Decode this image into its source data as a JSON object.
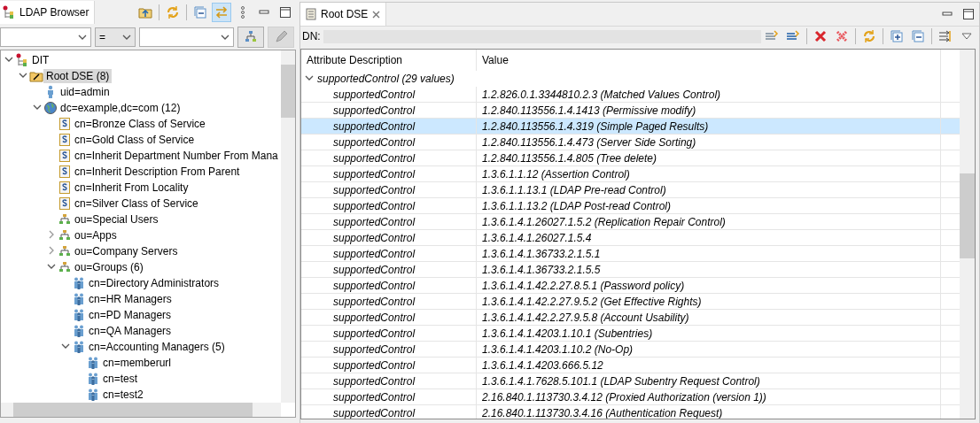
{
  "browser": {
    "title": "LDAP Browser",
    "tools": [
      {
        "kind": "open-connection",
        "pressed": false
      },
      {
        "kind": "refresh",
        "pressed": false
      },
      {
        "kind": "collapse",
        "pressed": false
      },
      {
        "kind": "link",
        "pressed": true
      },
      {
        "kind": "menu",
        "pressed": false
      },
      {
        "kind": "minimize",
        "pressed": false
      },
      {
        "kind": "maximize",
        "pressed": false
      }
    ],
    "filter": {
      "operator": "=",
      "buttons": [
        {
          "kind": "tree",
          "disabled": false
        },
        {
          "kind": "pencil",
          "disabled": true
        }
      ]
    },
    "tree": [
      {
        "label": "DIT",
        "kind": "dit",
        "expanded": true,
        "selected": false,
        "children": [
          {
            "label": "Root DSE (8)",
            "kind": "root",
            "expanded": true,
            "selected": true,
            "children": [
              {
                "label": "uid=admin",
                "kind": "person",
                "selected": false
              },
              {
                "label": "dc=example,dc=com (12)",
                "kind": "domain",
                "expanded": true,
                "selected": false,
                "children": [
                  {
                    "label": "cn=Bronze Class of Service",
                    "kind": "subentry",
                    "selected": false
                  },
                  {
                    "label": "cn=Gold Class of Service",
                    "kind": "subentry",
                    "selected": false
                  },
                  {
                    "label": "cn=Inherit Department Number From Mana",
                    "kind": "subentry",
                    "selected": false
                  },
                  {
                    "label": "cn=Inherit Description From Parent",
                    "kind": "subentry",
                    "selected": false
                  },
                  {
                    "label": "cn=Inherit From Locality",
                    "kind": "subentry",
                    "selected": false
                  },
                  {
                    "label": "cn=Silver Class of Service",
                    "kind": "subentry",
                    "selected": false
                  },
                  {
                    "label": "ou=Special Users",
                    "kind": "ou",
                    "selected": false
                  },
                  {
                    "label": "ou=Apps",
                    "kind": "ou",
                    "expanded": false,
                    "selected": false
                  },
                  {
                    "label": "ou=Company Servers",
                    "kind": "ou",
                    "expanded": false,
                    "selected": false
                  },
                  {
                    "label": "ou=Groups (6)",
                    "kind": "ou",
                    "expanded": true,
                    "selected": false,
                    "children": [
                      {
                        "label": "cn=Directory Administrators",
                        "kind": "group",
                        "selected": false
                      },
                      {
                        "label": "cn=HR Managers",
                        "kind": "group",
                        "selected": false
                      },
                      {
                        "label": "cn=PD Managers",
                        "kind": "group",
                        "selected": false
                      },
                      {
                        "label": "cn=QA Managers",
                        "kind": "group",
                        "selected": false
                      },
                      {
                        "label": "cn=Accounting Managers (5)",
                        "kind": "group",
                        "expanded": true,
                        "selected": false,
                        "children": [
                          {
                            "label": "cn=memberurl",
                            "kind": "group",
                            "selected": false
                          },
                          {
                            "label": "cn=test",
                            "kind": "group",
                            "selected": false
                          },
                          {
                            "label": "cn=test2",
                            "kind": "group",
                            "selected": false
                          }
                        ]
                      }
                    ]
                  }
                ]
              }
            ]
          }
        ]
      }
    ]
  },
  "editor": {
    "tab": {
      "title": "Root DSE"
    },
    "window_tools": [
      {
        "kind": "minimize"
      },
      {
        "kind": "maximize"
      }
    ],
    "dn": {
      "label": "DN:"
    },
    "tools": [
      {
        "kind": "new-attribute"
      },
      {
        "kind": "new-value"
      },
      {
        "kind": "delete"
      },
      {
        "kind": "delete-all"
      },
      {
        "kind": "refresh"
      },
      {
        "kind": "expand-all"
      },
      {
        "kind": "collapse-all"
      },
      {
        "kind": "show-raw"
      },
      {
        "kind": "dropdown"
      }
    ],
    "table": {
      "columns": [
        "Attribute Description",
        "Value"
      ],
      "group": {
        "label": "supportedControl (29 values)",
        "expanded": true
      },
      "rows": [
        {
          "attribute": "supportedControl",
          "value": "1.2.826.0.1.3344810.2.3 (Matched Values Control)",
          "selected": false
        },
        {
          "attribute": "supportedControl",
          "value": "1.2.840.113556.1.4.1413 (Permissive modify)",
          "selected": false
        },
        {
          "attribute": "supportedControl",
          "value": "1.2.840.113556.1.4.319 (Simple Paged Results)",
          "selected": true
        },
        {
          "attribute": "supportedControl",
          "value": "1.2.840.113556.1.4.473 (Server Side Sorting)",
          "selected": false
        },
        {
          "attribute": "supportedControl",
          "value": "1.2.840.113556.1.4.805 (Tree delete)",
          "selected": false
        },
        {
          "attribute": "supportedControl",
          "value": "1.3.6.1.1.12 (Assertion Control)",
          "selected": false
        },
        {
          "attribute": "supportedControl",
          "value": "1.3.6.1.1.13.1 (LDAP Pre-read Control)",
          "selected": false
        },
        {
          "attribute": "supportedControl",
          "value": "1.3.6.1.1.13.2 (LDAP Post-read Control)",
          "selected": false
        },
        {
          "attribute": "supportedControl",
          "value": "1.3.6.1.4.1.26027.1.5.2 (Replication Repair Control)",
          "selected": false
        },
        {
          "attribute": "supportedControl",
          "value": "1.3.6.1.4.1.26027.1.5.4",
          "selected": false
        },
        {
          "attribute": "supportedControl",
          "value": "1.3.6.1.4.1.36733.2.1.5.1",
          "selected": false
        },
        {
          "attribute": "supportedControl",
          "value": "1.3.6.1.4.1.36733.2.1.5.5",
          "selected": false
        },
        {
          "attribute": "supportedControl",
          "value": "1.3.6.1.4.1.42.2.27.8.5.1 (Password policy)",
          "selected": false
        },
        {
          "attribute": "supportedControl",
          "value": "1.3.6.1.4.1.42.2.27.9.5.2 (Get Effective Rights)",
          "selected": false
        },
        {
          "attribute": "supportedControl",
          "value": "1.3.6.1.4.1.42.2.27.9.5.8 (Account Usability)",
          "selected": false
        },
        {
          "attribute": "supportedControl",
          "value": "1.3.6.1.4.1.4203.1.10.1 (Subentries)",
          "selected": false
        },
        {
          "attribute": "supportedControl",
          "value": "1.3.6.1.4.1.4203.1.10.2 (No-Op)",
          "selected": false
        },
        {
          "attribute": "supportedControl",
          "value": "1.3.6.1.4.1.4203.666.5.12",
          "selected": false
        },
        {
          "attribute": "supportedControl",
          "value": "1.3.6.1.4.1.7628.5.101.1 (LDAP Subentry Request Control)",
          "selected": false
        },
        {
          "attribute": "supportedControl",
          "value": "2.16.840.1.113730.3.4.12 (Proxied Authorization (version 1))",
          "selected": false
        },
        {
          "attribute": "supportedControl",
          "value": "2.16.840.1.113730.3.4.16 (Authentication Request)",
          "selected": false
        }
      ]
    }
  }
}
